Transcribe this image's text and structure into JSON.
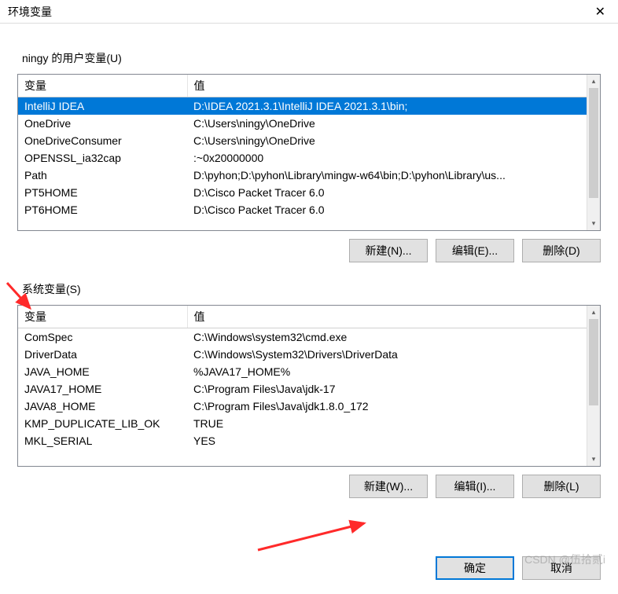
{
  "title": "环境变量",
  "close_symbol": "✕",
  "user_section": {
    "label": "ningy 的用户变量(U)",
    "col_variable": "变量",
    "col_value": "值",
    "rows": [
      {
        "name": "IntelliJ IDEA",
        "value": "D:\\IDEA 2021.3.1\\IntelliJ IDEA 2021.3.1\\bin;",
        "selected": true
      },
      {
        "name": "OneDrive",
        "value": "C:\\Users\\ningy\\OneDrive"
      },
      {
        "name": "OneDriveConsumer",
        "value": "C:\\Users\\ningy\\OneDrive"
      },
      {
        "name": "OPENSSL_ia32cap",
        "value": ":~0x20000000"
      },
      {
        "name": "Path",
        "value": "D:\\pyhon;D:\\pyhon\\Library\\mingw-w64\\bin;D:\\pyhon\\Library\\us..."
      },
      {
        "name": "PT5HOME",
        "value": "D:\\Cisco Packet Tracer 6.0"
      },
      {
        "name": "PT6HOME",
        "value": "D:\\Cisco Packet Tracer 6.0"
      }
    ],
    "buttons": {
      "new": "新建(N)...",
      "edit": "编辑(E)...",
      "delete": "删除(D)"
    }
  },
  "system_section": {
    "label": "系统变量(S)",
    "col_variable": "变量",
    "col_value": "值",
    "rows": [
      {
        "name": "ComSpec",
        "value": "C:\\Windows\\system32\\cmd.exe"
      },
      {
        "name": "DriverData",
        "value": "C:\\Windows\\System32\\Drivers\\DriverData"
      },
      {
        "name": "JAVA_HOME",
        "value": "%JAVA17_HOME%"
      },
      {
        "name": "JAVA17_HOME",
        "value": "C:\\Program Files\\Java\\jdk-17"
      },
      {
        "name": "JAVA8_HOME",
        "value": "C:\\Program Files\\Java\\jdk1.8.0_172"
      },
      {
        "name": "KMP_DUPLICATE_LIB_OK",
        "value": "TRUE"
      },
      {
        "name": "MKL_SERIAL",
        "value": "YES"
      }
    ],
    "buttons": {
      "new": "新建(W)...",
      "edit": "编辑(I)...",
      "delete": "删除(L)"
    }
  },
  "footer": {
    "ok": "确定",
    "cancel": "取消"
  },
  "watermark": "CSDN @伍拾贰i"
}
